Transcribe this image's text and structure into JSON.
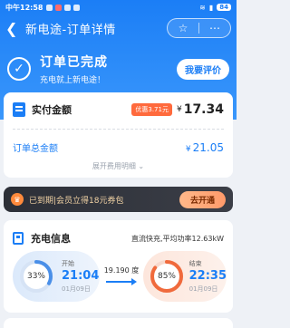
{
  "status_bar": {
    "carrier": "中午12:58",
    "battery": "84"
  },
  "nav": {
    "back_icon": "back-arrow-icon",
    "title": "新电途-订单详情"
  },
  "order_status": {
    "title": "订单已完成",
    "subtitle": "充电就上新电途！",
    "review_label": "我要评价"
  },
  "payment": {
    "label": "实付金额",
    "discount_badge": "优惠3.71元",
    "currency": "¥",
    "amount": "17.34",
    "total_label": "订单总金额",
    "total_amount": "21.05",
    "expand_label": "展开费用明细"
  },
  "member": {
    "text": "已到期|会员立得18元券包",
    "button_label": "去开通"
  },
  "charging": {
    "title": "充电信息",
    "info": "直流快充,平均功率12.63kW",
    "start": {
      "label": "开始",
      "percent_text": "33%",
      "percent": 33,
      "time": "21:04",
      "date": "01月09日"
    },
    "energy": "19.190 度",
    "end": {
      "label": "结束",
      "percent_text": "85%",
      "percent": 85,
      "time": "22:35",
      "date": "01月09日"
    }
  },
  "colors": {
    "primary": "#1b7ef6",
    "start_ring": "#4a8fe8",
    "end_ring": "#f06a3c",
    "accent": "#ff6a3d"
  }
}
